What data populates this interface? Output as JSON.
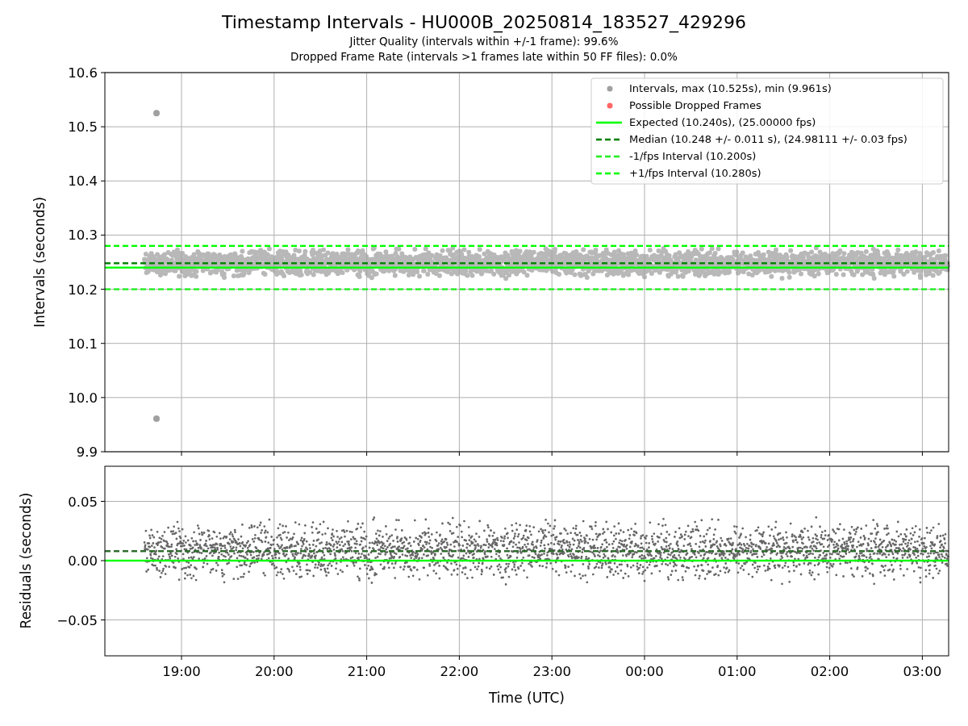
{
  "title": "Timestamp Intervals - HU000B_20250814_183527_429296",
  "subtitles": [
    "Jitter Quality (intervals within +/-1 frame): 99.6%",
    "Dropped Frame Rate (intervals >1 frames late within 50 FF files): 0.0%"
  ],
  "legend": [
    {
      "label": "Intervals, max (10.525s), min (9.961s)",
      "color": "#a0a0a0",
      "kind": "dot"
    },
    {
      "label": "Possible Dropped Frames",
      "color": "#ff6666",
      "kind": "dot"
    },
    {
      "label": "Expected (10.240s), (25.00000 fps)",
      "color": "#00ff00",
      "kind": "solid"
    },
    {
      "label": "Median (10.248 +/- 0.011 s), (24.98111 +/- 0.03 fps)",
      "color": "#008000",
      "kind": "dashed"
    },
    {
      "label": "-1/fps Interval (10.200s)",
      "color": "#22ee22",
      "kind": "dashed"
    },
    {
      "label": "+1/fps Interval (10.280s)",
      "color": "#00ff00",
      "kind": "dashed"
    }
  ],
  "top_plot": {
    "ylabel": "Intervals (seconds)",
    "yticks": [
      "10.6",
      "10.5",
      "10.4",
      "10.3",
      "10.2",
      "10.1",
      "10.0",
      "9.9"
    ]
  },
  "bottom_plot": {
    "ylabel": "Residuals (seconds)",
    "xlabel": "Time (UTC)",
    "yticks": [
      "0.05",
      "0.00",
      "−0.05"
    ],
    "xticks": [
      "19:00",
      "20:00",
      "21:00",
      "22:00",
      "23:00",
      "00:00",
      "01:00",
      "02:00",
      "03:00"
    ]
  }
}
